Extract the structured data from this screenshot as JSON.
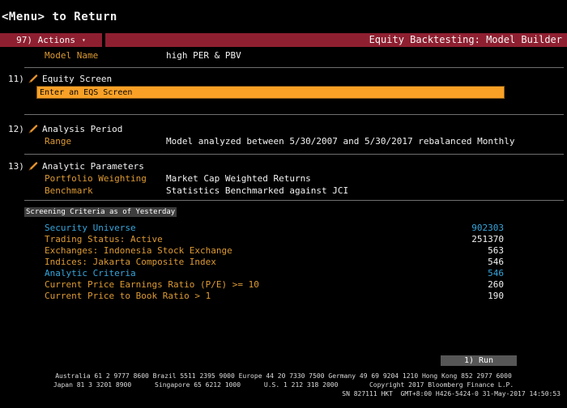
{
  "header": {
    "menu_hint": "<Menu> to Return",
    "actions_label": "97) Actions",
    "title": "Equity Backtesting: Model Builder"
  },
  "model": {
    "label": "Model Name",
    "value": "high PER & PBV"
  },
  "sections": {
    "equity_screen": {
      "number": "11)",
      "title": "Equity Screen",
      "input_value": "Enter an EQS Screen"
    },
    "analysis_period": {
      "number": "12)",
      "title": "Analysis Period",
      "range_label": "Range",
      "range_value": "Model analyzed between 5/30/2007 and 5/30/2017 rebalanced Monthly"
    },
    "analytic_parameters": {
      "number": "13)",
      "title": "Analytic Parameters",
      "rows": [
        {
          "label": "Portfolio Weighting",
          "value": "Market Cap Weighted Returns"
        },
        {
          "label": "Benchmark",
          "value": "Statistics Benchmarked against JCI"
        }
      ]
    }
  },
  "screening": {
    "header": "Screening Criteria as of Yesterday",
    "rows": [
      {
        "label": "Security Universe",
        "value": "902303"
      },
      {
        "label": "Trading Status: Active",
        "value": "251370"
      },
      {
        "label": "Exchanges: Indonesia Stock Exchange",
        "value": "563"
      },
      {
        "label": "Indices: Jakarta Composite Index",
        "value": "546"
      },
      {
        "label": "Analytic Criteria",
        "value": "546"
      },
      {
        "label": "Current Price Earnings Ratio (P/E) >= 10",
        "value": "260"
      },
      {
        "label": "Current Price to Book Ratio > 1",
        "value": "190"
      }
    ]
  },
  "run_button": "1) Run",
  "footer": {
    "line1": "Australia 61 2 9777 8600 Brazil 5511 2395 9000 Europe 44 20 7330 7500 Germany 49 69 9204 1210 Hong Kong 852 2977 6000",
    "line2": "Japan 81 3 3201 8900      Singapore 65 6212 1000      U.S. 1 212 318 2000        Copyright 2017 Bloomberg Finance L.P.",
    "line3": "SN 827111 HKT  GMT+8:00 H426-5424-0 31-May-2017 14:50:53"
  },
  "colors": {
    "bar_red": "#8e1f30",
    "label_orange": "#dd9a33",
    "input_orange": "#f9a127",
    "highlight_cyan": "#36a5db",
    "button_gray": "#565656"
  }
}
